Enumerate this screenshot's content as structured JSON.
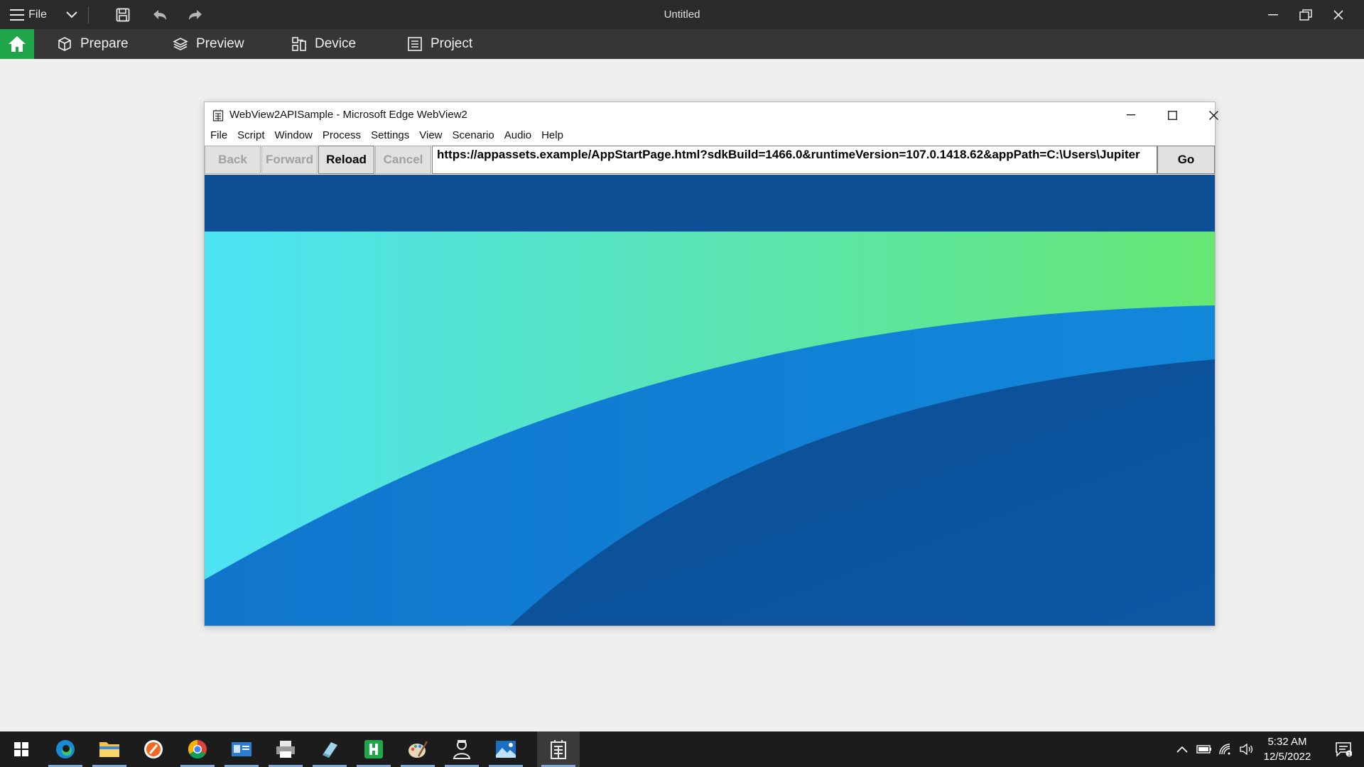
{
  "app": {
    "title": "Untitled",
    "file_menu_label": "File"
  },
  "ribbon": {
    "tabs": [
      {
        "label": "Prepare",
        "icon": "cube-icon"
      },
      {
        "label": "Preview",
        "icon": "layers-icon"
      },
      {
        "label": "Device",
        "icon": "device-icon"
      },
      {
        "label": "Project",
        "icon": "list-icon"
      }
    ],
    "home_color": "#1fa64a"
  },
  "webview": {
    "title": "WebView2APISample - Microsoft Edge WebView2",
    "menu": [
      "File",
      "Script",
      "Window",
      "Process",
      "Settings",
      "View",
      "Scenario",
      "Audio",
      "Help"
    ],
    "buttons": {
      "back": "Back",
      "forward": "Forward",
      "reload": "Reload",
      "cancel": "Cancel",
      "go": "Go"
    },
    "url": "https://appassets.example/AppStartPage.html?sdkBuild=1466.0&runtimeVersion=107.0.1418.62&appPath=C:\\Users\\Jupiter"
  },
  "taskbar": {
    "apps": [
      "start-icon",
      "edge-icon",
      "file-explorer-icon",
      "orange-app-icon",
      "chrome-icon",
      "id-card-app-icon",
      "printer-app-icon",
      "eraser-app-icon",
      "green-app-icon",
      "paint-app-icon",
      "person-app-icon",
      "photos-app-icon",
      "building-app-icon"
    ],
    "time": "5:32 AM",
    "date": "12/5/2022"
  }
}
